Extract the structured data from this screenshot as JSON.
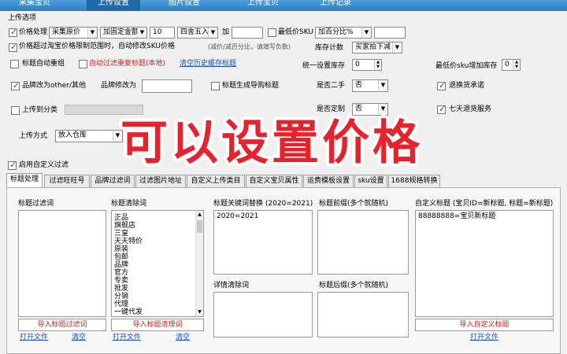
{
  "top_tabs": [
    "采集宝贝",
    "上传设置",
    "图片设置",
    "上传宝贝",
    "上传记录"
  ],
  "active_top_tab": 1,
  "section_title": "上传选项",
  "row1": {
    "price_label": "价格处理",
    "price_source": "采集原价",
    "price_mode": "加固定金额",
    "price_value": "10",
    "rounding": "四舍五入",
    "add_label": "加",
    "add_value": "",
    "min_sku_label": "最低价SKU",
    "min_sku_mode": "加百分比%",
    "min_sku_value": ""
  },
  "row2": {
    "over_limit_label": "价格超过淘宝价格限制范围时，自动修改SKU价格",
    "hint": "(减价/减百分比，请填写负数)",
    "stock_count_label": "库存计数",
    "stock_count_value": "买家拍下减"
  },
  "row3": {
    "title_regroup": "标题自动重组",
    "auto_filter": "自动过滤重复标题(本地)",
    "clear_cache": "清空历史缓存标题",
    "unified_stock_label": "统一设置库存",
    "unified_stock_value": "0",
    "min_sku_stock_label": "最低价sku增加库存",
    "min_sku_stock_value": "0"
  },
  "row4": {
    "brand_other": "品牌改为other/其他",
    "brand_change_label": "品牌修改为",
    "brand_change_value": "",
    "title_gen": "标题生成导购标题",
    "second_hand_label": "是否二手",
    "second_hand_value": "否",
    "return_promise": "退换货承诺"
  },
  "row5": {
    "upload_category": "上传到分类",
    "custom_label": "是否定制",
    "custom_value": "否",
    "seven_day": "七天退货服务"
  },
  "row6": {
    "upload_method_label": "上传方式",
    "upload_method_value": "放入仓库"
  },
  "enable_filter": "启用自定义过滤",
  "sub_tabs": [
    "标题处理",
    "过滤旺旺号",
    "品牌过滤词",
    "过滤图片地址",
    "自定义上传类目",
    "自定义宝贝属性",
    "运费模板设置",
    "sku设置",
    "1688规格转换"
  ],
  "active_sub_tab": 0,
  "panel": {
    "col1": {
      "title": "标题过滤词",
      "import": "导入标题过滤词",
      "open": "打开文件",
      "clear": "清空"
    },
    "col2": {
      "title": "标题清除词",
      "items": [
        "正品",
        "旗舰店",
        "三皇",
        "天天特价",
        "原装",
        "包邮",
        "品牌",
        "官方",
        "专卖",
        "批发",
        "分销",
        "代理",
        "一键代发"
      ],
      "import": "导入标题清理词",
      "open": "打开文件",
      "clear": "清空"
    },
    "col3": {
      "title": "标题关键词替换 (2020=2021)",
      "value": "2020=2021",
      "detail_title": "详情清除词"
    },
    "col4": {
      "title": "标题前缀(多个就随机)",
      "suffix_title": "标题后缀(多个就随机)"
    },
    "col5": {
      "title": "自定义标题 (宝贝ID=新标题, 标题=新标题)",
      "value": "88888888=宝贝新标题",
      "import": "导入自定义标题",
      "open": "打开文件"
    }
  },
  "overlay_text": "可以设置价格"
}
